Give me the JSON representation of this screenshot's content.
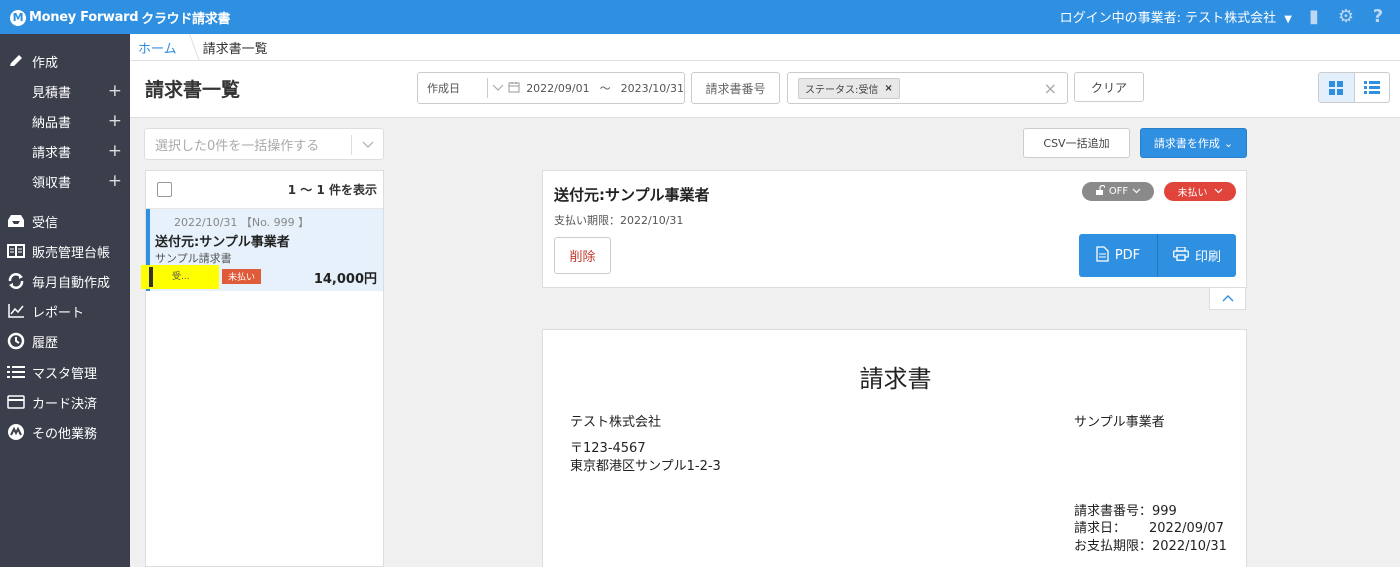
{
  "app": {
    "brand": "Money Forward",
    "product": "クラウド請求書",
    "logo_mark": "M",
    "user_label": "ログイン中の事業者: テスト株式会社"
  },
  "icons": {
    "user_caret": "▼",
    "beginner": "▮",
    "settings": "⚙",
    "help": "?"
  },
  "sidebar": {
    "items": [
      {
        "label": "作成",
        "icon": "pencil-icon"
      },
      {
        "label": "受信",
        "icon": "inbox-icon"
      },
      {
        "label": "販売管理台帳",
        "icon": "ledger-icon"
      },
      {
        "label": "毎月自動作成",
        "icon": "repeat-icon"
      },
      {
        "label": "レポート",
        "icon": "chart-icon"
      },
      {
        "label": "履歴",
        "icon": "history-icon"
      },
      {
        "label": "マスタ管理",
        "icon": "list-icon"
      },
      {
        "label": "カード決済",
        "icon": "card-icon"
      },
      {
        "label": "その他業務",
        "icon": "mf-icon"
      }
    ],
    "sub_items": [
      {
        "label": "見積書",
        "add": "+"
      },
      {
        "label": "納品書",
        "add": "+"
      },
      {
        "label": "請求書",
        "add": "+"
      },
      {
        "label": "領収書",
        "add": "+"
      }
    ]
  },
  "breadcrumb": {
    "home": "ホーム",
    "current": "請求書一覧"
  },
  "header": {
    "title": "請求書一覧",
    "date_type": "作成日",
    "date_from": "2022/09/01",
    "date_sep": "～",
    "date_to": "2023/10/31",
    "invoice_number_placeholder": "請求書番号",
    "status_chip": "ステータス:受信",
    "chip_remove": "×",
    "clear_x": "×",
    "clear_button": "クリア"
  },
  "list": {
    "bulk_placeholder": "選択した0件を一括操作する",
    "count_text": "1 ～ 1 件を表示",
    "rows": [
      {
        "date_no": "2022/10/31 【No. 999 】",
        "title": "送付元:サンプル事業者",
        "subtitle": "サンプル請求書",
        "status_received": "受...",
        "status_unpaid": "未払い",
        "amount": "14,000円"
      }
    ]
  },
  "actions": {
    "csv_button": "CSV一括追加",
    "create_button": "請求書を作成",
    "create_caret": "⌄"
  },
  "detail": {
    "sender": "送付元:サンプル事業者",
    "due_date": "支払い期限：2022/10/31",
    "delete_button": "削除",
    "lock_state": "OFF",
    "payment_state": "未払い",
    "pdf_button": "PDF",
    "print_button": "印刷"
  },
  "document": {
    "title": "請求書",
    "issuer_name": "テスト株式会社",
    "issuer_zip": "〒123-4567",
    "issuer_address": "東京都港区サンプル1-2-3",
    "recipient_name": "サンプル事業者",
    "invoice_number": "請求書番号：999",
    "invoice_date_label": "請求日：",
    "invoice_date": "2022/09/07",
    "due_label": "お支払期限：2022/10/31"
  },
  "colors": {
    "topbar": "#2f8fe0",
    "sidebar": "#3a3f4b",
    "accent": "#2f8fe0",
    "unpaid": "#e0443b",
    "highlight": "#ffff00"
  }
}
